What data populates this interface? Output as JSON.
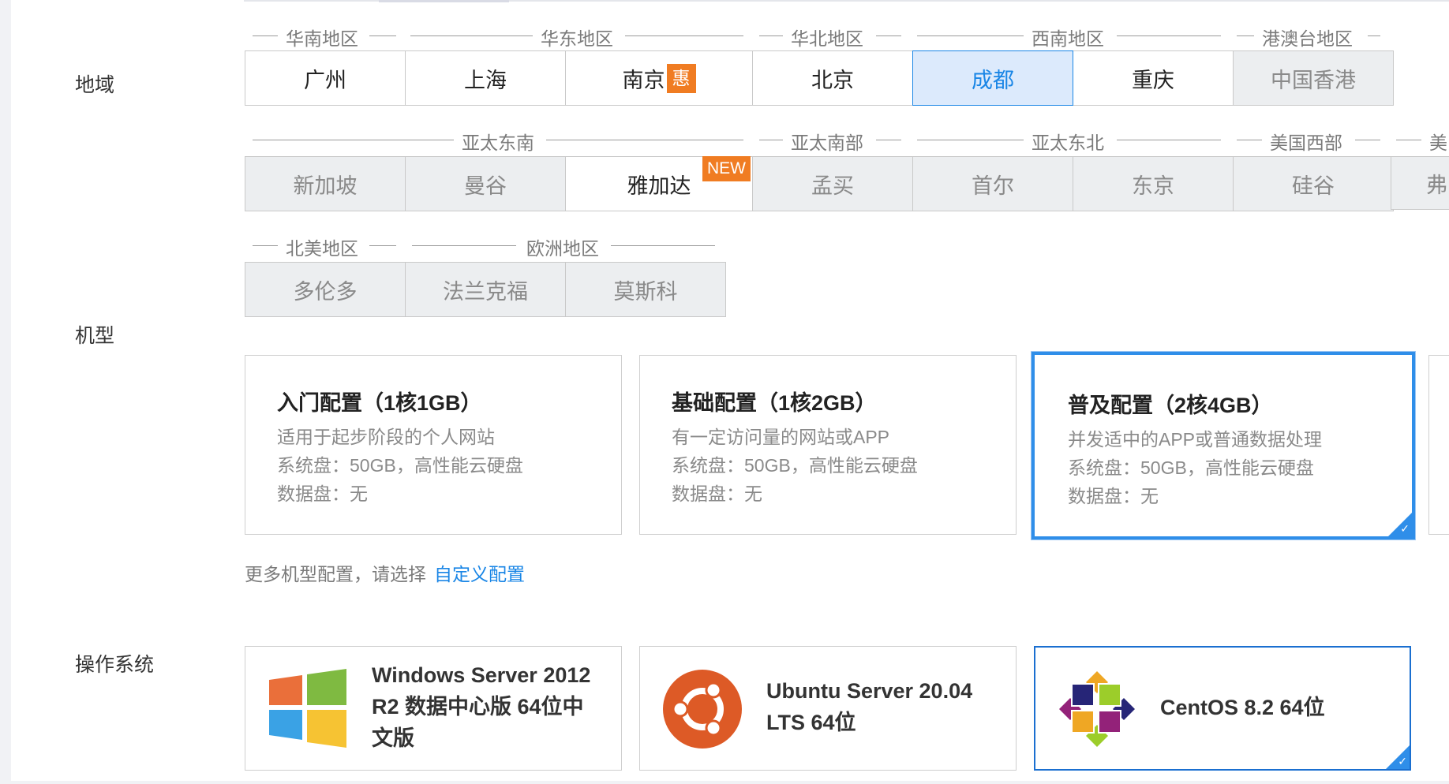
{
  "sections": {
    "region": "地域",
    "machine": "机型",
    "os": "操作系统"
  },
  "region_groups_row1": [
    "华南地区",
    "华东地区",
    "华北地区",
    "西南地区",
    "港澳台地区"
  ],
  "region_groups_row2": [
    "亚太东南",
    "亚太南部",
    "亚太东北",
    "美国西部",
    "美"
  ],
  "region_groups_row3": [
    "北美地区",
    "欧洲地区"
  ],
  "regions_row1": [
    "广州",
    "上海",
    "南京",
    "北京",
    "成都",
    "重庆",
    "中国香港"
  ],
  "regions_row2": [
    "新加坡",
    "曼谷",
    "雅加达",
    "孟买",
    "首尔",
    "东京",
    "硅谷",
    "弗"
  ],
  "regions_row3": [
    "多伦多",
    "法兰克福",
    "莫斯科"
  ],
  "badges": {
    "hui": "惠",
    "new": "NEW"
  },
  "machines": [
    {
      "title": "入门配置（1核1GB）",
      "desc": "适用于起步阶段的个人网站",
      "disk": "系统盘：50GB，高性能云硬盘",
      "data_disk": "数据盘：无"
    },
    {
      "title": "基础配置（1核2GB）",
      "desc": "有一定访问量的网站或APP",
      "disk": "系统盘：50GB，高性能云硬盘",
      "data_disk": "数据盘：无"
    },
    {
      "title": "普及配置（2核4GB）",
      "desc": "并发适中的APP或普通数据处理",
      "disk": "系统盘：50GB，高性能云硬盘",
      "data_disk": "数据盘：无"
    }
  ],
  "more_config": {
    "prefix": "更多机型配置，请选择",
    "link": "自定义配置"
  },
  "os_options": [
    {
      "line1": "Windows Server 2012",
      "line2": "R2 数据中心版 64位中",
      "line3": "文版"
    },
    {
      "line1": "Ubuntu Server 20.04",
      "line2": "LTS 64位"
    },
    {
      "line1": "CentOS 8.2 64位"
    }
  ],
  "colors": {
    "accent": "#1a86e6",
    "badge": "#f07c22",
    "selected_bg": "#dceafc"
  }
}
